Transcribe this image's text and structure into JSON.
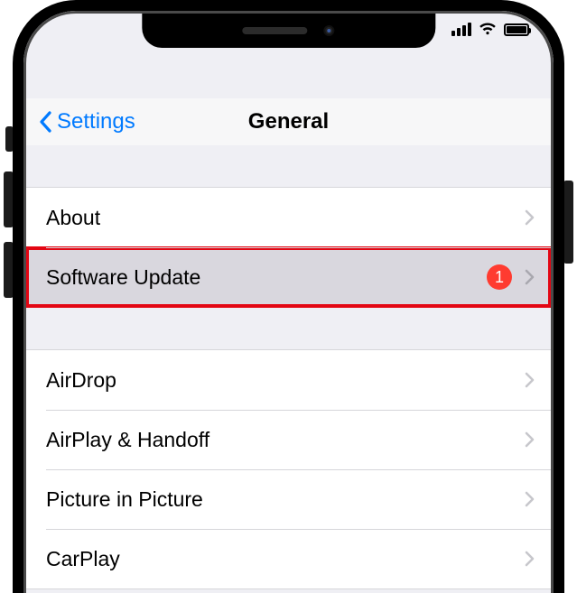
{
  "nav": {
    "back_label": "Settings",
    "title": "General"
  },
  "group1": [
    {
      "label": "About",
      "badge": null,
      "highlight": false
    },
    {
      "label": "Software Update",
      "badge": "1",
      "highlight": true
    }
  ],
  "group2": [
    {
      "label": "AirDrop"
    },
    {
      "label": "AirPlay & Handoff"
    },
    {
      "label": "Picture in Picture"
    },
    {
      "label": "CarPlay"
    }
  ],
  "colors": {
    "accent": "#007aff",
    "badge": "#ff3b30",
    "highlight_border": "#e30613"
  }
}
